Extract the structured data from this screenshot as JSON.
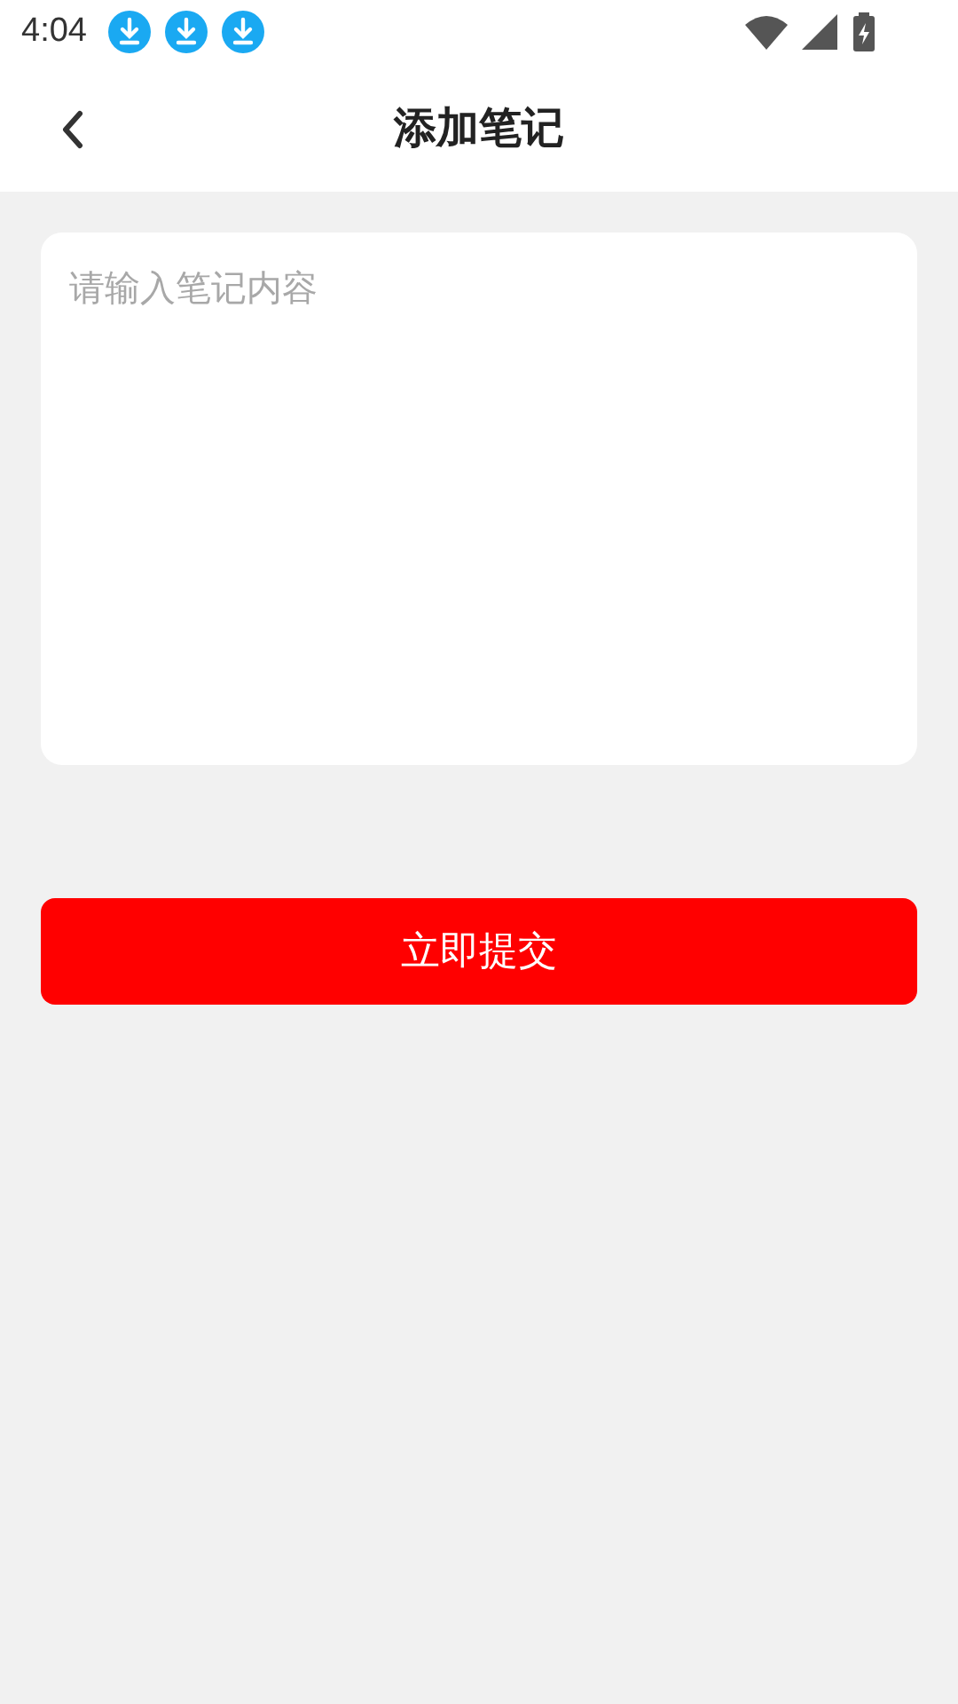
{
  "status_bar": {
    "time": "4:04",
    "notifications": [
      {
        "kind": "download"
      },
      {
        "kind": "download"
      },
      {
        "kind": "download"
      }
    ]
  },
  "header": {
    "title": "添加笔记"
  },
  "note_field": {
    "placeholder": "请输入笔记内容"
  },
  "submit_button": {
    "label": "立即提交"
  }
}
